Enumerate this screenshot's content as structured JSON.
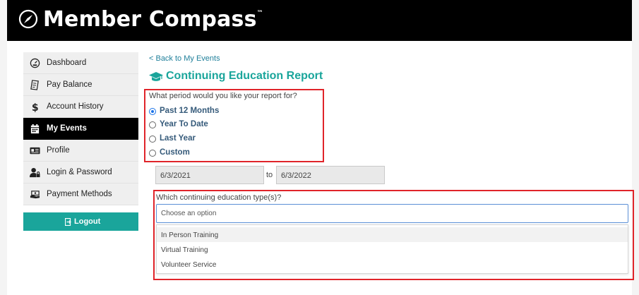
{
  "brand": {
    "name": "Member Compass",
    "tm": "™"
  },
  "sidebar": {
    "items": [
      {
        "label": "Dashboard",
        "icon": "dashboard-gauge-icon",
        "active": false
      },
      {
        "label": "Pay Balance",
        "icon": "receipt-icon",
        "active": false
      },
      {
        "label": "Account History",
        "icon": "dollar-icon",
        "active": false
      },
      {
        "label": "My Events",
        "icon": "calendar-icon",
        "active": true
      },
      {
        "label": "Profile",
        "icon": "id-card-icon",
        "active": false
      },
      {
        "label": "Login & Password",
        "icon": "user-lock-icon",
        "active": false
      },
      {
        "label": "Payment Methods",
        "icon": "money-hand-icon",
        "active": false
      }
    ],
    "logout_label": "Logout"
  },
  "main": {
    "back_link": "< Back to My Events",
    "title": "Continuing Education Report",
    "period_question": "What period would you like your report for?",
    "period_options": [
      {
        "label": "Past 12 Months",
        "checked": true
      },
      {
        "label": "Year To Date",
        "checked": false
      },
      {
        "label": "Last Year",
        "checked": false
      },
      {
        "label": "Custom",
        "checked": false
      }
    ],
    "date_from": "6/3/2021",
    "date_to_label": "to",
    "date_to": "6/3/2022",
    "type_question": "Which continuing education type(s)?",
    "type_placeholder": "Choose an option",
    "type_options": [
      "In Person Training",
      "Virtual Training",
      "Volunteer Service"
    ]
  },
  "colors": {
    "accent": "#1aa59b",
    "highlight_border": "#e0242a",
    "topbar": "#000000",
    "link": "#1f7f9a"
  }
}
